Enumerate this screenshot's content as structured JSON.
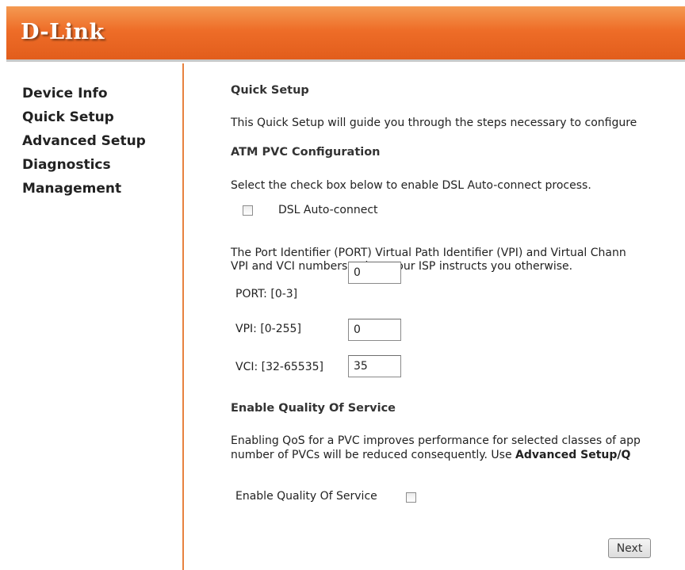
{
  "header": {
    "logo": "D-Link"
  },
  "sidebar": {
    "items": [
      {
        "label": "Device Info"
      },
      {
        "label": "Quick Setup"
      },
      {
        "label": "Advanced Setup"
      },
      {
        "label": "Diagnostics"
      },
      {
        "label": "Management"
      }
    ]
  },
  "main": {
    "title": "Quick Setup",
    "intro": "This Quick Setup will guide you through the steps necessary to configure",
    "atm_heading": "ATM PVC Configuration",
    "auto_connect_prompt": "Select the check box below to enable DSL Auto-connect process.",
    "auto_connect_label": "DSL Auto-connect",
    "auto_connect_checked": false,
    "port_info_line1": "The Port Identifier (PORT) Virtual Path Identifier (VPI) and Virtual Chann",
    "port_info_line2": "VPI and VCI numbers unless your ISP instructs you otherwise.",
    "fields": [
      {
        "label": "PORT: [0-3]",
        "value": "0"
      },
      {
        "label": "VPI: [0-255]",
        "value": "0"
      },
      {
        "label": "VCI: [32-65535]",
        "value": "35"
      }
    ],
    "qos_heading": "Enable Quality Of Service",
    "qos_info_line1": "Enabling QoS for a PVC improves performance for selected classes of app",
    "qos_info_line2_prefix": "number of PVCs will be reduced consequently. Use ",
    "qos_info_line2_bold": "Advanced Setup/Q",
    "qos_label": "Enable Quality Of Service",
    "qos_checked": false,
    "next_label": "Next"
  },
  "colors": {
    "header_orange": "#ee6d28",
    "divider_orange": "#e7823f"
  }
}
